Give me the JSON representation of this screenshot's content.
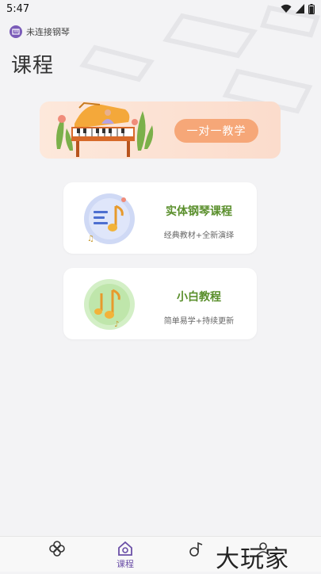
{
  "status_bar": {
    "time": "5:47"
  },
  "piano_connection": {
    "text": "未连接钢琴",
    "icon": "piano-icon"
  },
  "page": {
    "title": "课程"
  },
  "banner": {
    "button_label": "一对一教学"
  },
  "cards": [
    {
      "title": "实体钢琴课程",
      "subtitle": "经典教材+全新演绎",
      "icon": "music-note-icon",
      "accent": "#5a8f2c"
    },
    {
      "title": "小白教程",
      "subtitle": "简单易学+持续更新",
      "icon": "music-notes-icon",
      "accent": "#5a8f2c"
    }
  ],
  "bottom_nav": {
    "items": [
      {
        "label": "",
        "icon": "flower-icon"
      },
      {
        "label": "课程",
        "icon": "course-icon",
        "active": true
      },
      {
        "label": "",
        "icon": "music-icon"
      },
      {
        "label": "",
        "icon": "profile-icon"
      }
    ]
  },
  "watermark": {
    "text": "大玩家"
  },
  "colors": {
    "accent_purple": "#6b4fa7",
    "banner_button": "#f6a778",
    "card_title": "#5a8f2c"
  }
}
